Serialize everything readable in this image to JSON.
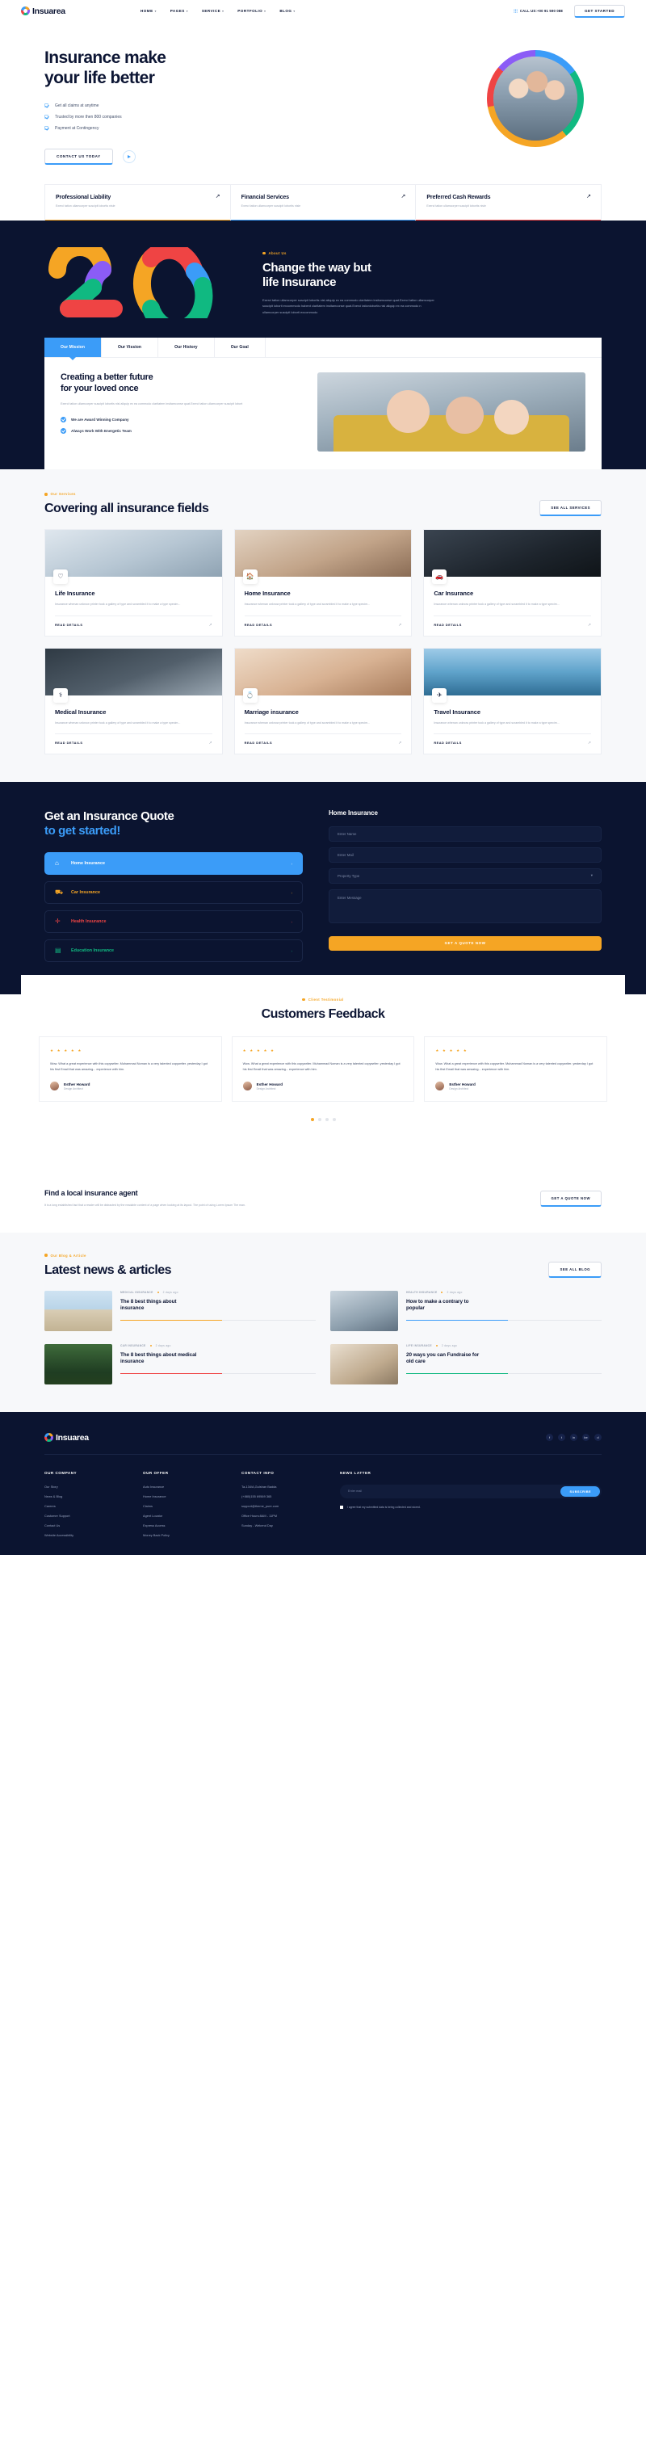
{
  "header": {
    "brand": "Insuarea",
    "nav": [
      {
        "label": "HOME",
        "caret": "▾"
      },
      {
        "label": "PAGES",
        "caret": "▾"
      },
      {
        "label": "SERVICE",
        "caret": "▾"
      },
      {
        "label": "PORTFOLIO",
        "caret": "▾"
      },
      {
        "label": "BLOG",
        "caret": "▾"
      }
    ],
    "call_label": "CALL US:+00 91 590 088",
    "cta": "GET STARTED"
  },
  "hero": {
    "title_line1": "Insurance make",
    "title_line2": "your life better",
    "bullets": [
      "Get all claims at anytime",
      "Trusted by more then 800 companies",
      "Payment at Contingency"
    ],
    "cta": "CONTACT US TODAY",
    "play_icon": "play-icon"
  },
  "feature_cards": [
    {
      "title": "Professional Liability",
      "desc": "Exerci tation ullamcorper suscipit lobortis nisle",
      "arrow": "↗"
    },
    {
      "title": "Financial Services",
      "desc": "Exerci tation ullamcorper suscipit lobortis nisle",
      "arrow": "↗"
    },
    {
      "title": "Preferred Cash Rewards",
      "desc": "Exerci tation ullamcorper suscipit lobortis nisle",
      "arrow": "↗"
    }
  ],
  "about": {
    "big_number": "20",
    "eyebrow": "About Us",
    "title_line1": "Change the way but",
    "title_line2": "life Insurance",
    "body": "Exerci tation ullamcorper suscipit lobortis nisl aliquip ex ea commodo claritatem insitamconse quat.Exerci tation ullamcorper suscipit loborti excommodo habent claritatem insitamconse quat.Exerci tationlobortis nisl aliquip ex ea commodo n ullamcorper suscipit loborti excommodo",
    "tabs": [
      {
        "label": "Our Mission",
        "active": true
      },
      {
        "label": "Our Vission",
        "active": false
      },
      {
        "label": "Our History",
        "active": false
      },
      {
        "label": "Our Goal",
        "active": false
      }
    ],
    "panel_title_line1": "Creating a better future",
    "panel_title_line2": "for your loved once",
    "panel_body": "Exerci tation ullamcorper suscipit lobortis nisl aliquip ex ea commodo claritatem insitamconse quat.Exerci tation ullamcorper suscipit lobort",
    "ticks": [
      "We are Award Winning Company",
      "Always Work With Energetic Team"
    ]
  },
  "services": {
    "eyebrow": "Our Services",
    "title": "Covering all insurance fields",
    "cta": "SEE ALL SERVICES",
    "read_label": "READ DETAILS",
    "arrow": "↗",
    "items": [
      {
        "name": "Life Insurance",
        "desc": "Insurance whenan unknow printer took a gallery of type and scrambled it to make a type specim...",
        "icon": "life-icon",
        "glyph": "♡",
        "thumb": "t-life"
      },
      {
        "name": "Home Insurance",
        "desc": "Insurance whenan unknow printer took a gallery of type and scrambled it to make a type specim...",
        "icon": "home-icon",
        "glyph": "🏠",
        "thumb": "t-home"
      },
      {
        "name": "Car Insurance",
        "desc": "Insurance whenan unknow printer took a gallery of type and scrambled it to make a type specim...",
        "icon": "car-icon",
        "glyph": "🚗",
        "thumb": "t-car"
      },
      {
        "name": "Medical Insurance",
        "desc": "Insurance whenan unknow printer took a gallery of type and scrambled it to make a type specim...",
        "icon": "medical-icon",
        "glyph": "⚕",
        "thumb": "t-med"
      },
      {
        "name": "Marriage insurance",
        "desc": "Insurance whenan unknow printer took a gallery of type and scrambled it to make a type specim...",
        "icon": "rings-icon",
        "glyph": "💍",
        "thumb": "t-mar"
      },
      {
        "name": "Travel Insurance",
        "desc": "Insurance whenan unknow printer took a gallery of type and scrambled it to make a type specim...",
        "icon": "plane-icon",
        "glyph": "✈",
        "thumb": "t-trv"
      }
    ]
  },
  "quote": {
    "title_line1": "Get an Insurance Quote",
    "title_line2": "to get started!",
    "options": [
      {
        "label": "Home Insurance",
        "icon": "home-shield-icon",
        "glyph": "⌂",
        "active": true,
        "tone": "active"
      },
      {
        "label": "Car Insurance",
        "icon": "car-shield-icon",
        "glyph": "⛟",
        "active": false,
        "tone": "c-orange"
      },
      {
        "label": "Health Insurance",
        "icon": "heart-shield-icon",
        "glyph": "✛",
        "active": false,
        "tone": "c-red"
      },
      {
        "label": "Education Insurance",
        "icon": "book-icon",
        "glyph": "▤",
        "active": false,
        "tone": "c-green"
      }
    ],
    "chevron": "›",
    "form_title": "Home Insurance",
    "fields": {
      "name_placeholder": "Enter Name",
      "mail_placeholder": "Enter Mail",
      "property_placeholder": "Property Type",
      "message_placeholder": "Enter Message"
    },
    "submit": "GET A QUOTE NOW"
  },
  "testimonials": {
    "eyebrow": "Client Testimonial",
    "title": "Customers Feedback",
    "stars": "★ ★ ★ ★ ★",
    "items": [
      {
        "quote": "Wow. What a great experience with this copywriter. Muhammad Noman is a very talented copywriter. yesterday I got his first Email that was amazing... experience with him.",
        "name": "Esther Howard",
        "role": "Design Architect"
      },
      {
        "quote": "Wow. What a great experience with this copywriter. Muhammad Noman is a very talented copywriter. yesterday I got his first Email that was amazing... experience with him.",
        "name": "Esther Howard",
        "role": "Design Architect"
      },
      {
        "quote": "Wow. What a great experience with this copywriter. Muhammad Noman is a very talented copywriter. yesterday I got his first Email that was amazing... experience with him.",
        "name": "Esther Howard",
        "role": "Design Architect"
      }
    ],
    "dots": [
      true,
      false,
      false,
      false
    ]
  },
  "agent": {
    "title": "Find a local insurance agent",
    "body": "It is a long established fact that a reader will be distracted by the readable content of a page when looking at its layout. The point of using Lorem Ipsum The man.",
    "cta": "GET A QUOTE NOW"
  },
  "blog": {
    "eyebrow": "Our Blog & Article",
    "title": "Latest news & articles",
    "cta": "SEE ALL BLOG",
    "posts": [
      {
        "category": "MEDICAL INSURANCE",
        "date": "2 days ago",
        "title_line1": "The 8 best things about",
        "title_line2": "insurance",
        "thumb": "t-car",
        "accent": "or"
      },
      {
        "category": "HEALTH INSURANCE",
        "date": "2 days ago",
        "title_line1": "How to make a contrary to",
        "title_line2": "popular",
        "thumb": "t-lap",
        "accent": "bl"
      },
      {
        "category": "CAR INSURANCE",
        "date": "2 days ago",
        "title_line1": "The 8 best things about medical",
        "title_line2": "insurance",
        "thumb": "t-for",
        "accent": "rd"
      },
      {
        "category": "LIFE INSURANCE",
        "date": "2 days ago",
        "title_line1": "20 ways you can Fundraise for",
        "title_line2": "old care",
        "thumb": "t-old",
        "accent": "gr"
      }
    ]
  },
  "footer": {
    "brand": "Insuarea",
    "socials": [
      {
        "name": "facebook-icon",
        "glyph": "f"
      },
      {
        "name": "twitter-icon",
        "glyph": "t"
      },
      {
        "name": "linkedin-icon",
        "glyph": "in"
      },
      {
        "name": "behance-icon",
        "glyph": "be"
      },
      {
        "name": "dribbble-icon",
        "glyph": "d"
      }
    ],
    "columns": [
      {
        "heading": "OUR COMPANY",
        "links": [
          "Our Story",
          "News & Blog",
          "Careers",
          "Customer Support",
          "Contact Us",
          "Website Accessibility"
        ]
      },
      {
        "heading": "OUR OFFER",
        "links": [
          "Auto Insurance",
          "Home Insurance",
          "Claims",
          "Agent Locator",
          "Express Access",
          "Money Back Policy"
        ]
      },
      {
        "heading": "CONTACT INFO",
        "links": [
          "Ta-134/A,Gulshan Badda",
          "(+880)155 69569 365",
          "support@theme_pure.com",
          "Office Hours:8AM - 11PM",
          "Sunday - Wekend Day"
        ]
      }
    ],
    "newsletter": {
      "heading": "NEWS LATTER",
      "placeholder": "Enter mail",
      "button": "SUBSCRIBE",
      "agree": "I agree that my submitted data is being collected and stored."
    }
  }
}
